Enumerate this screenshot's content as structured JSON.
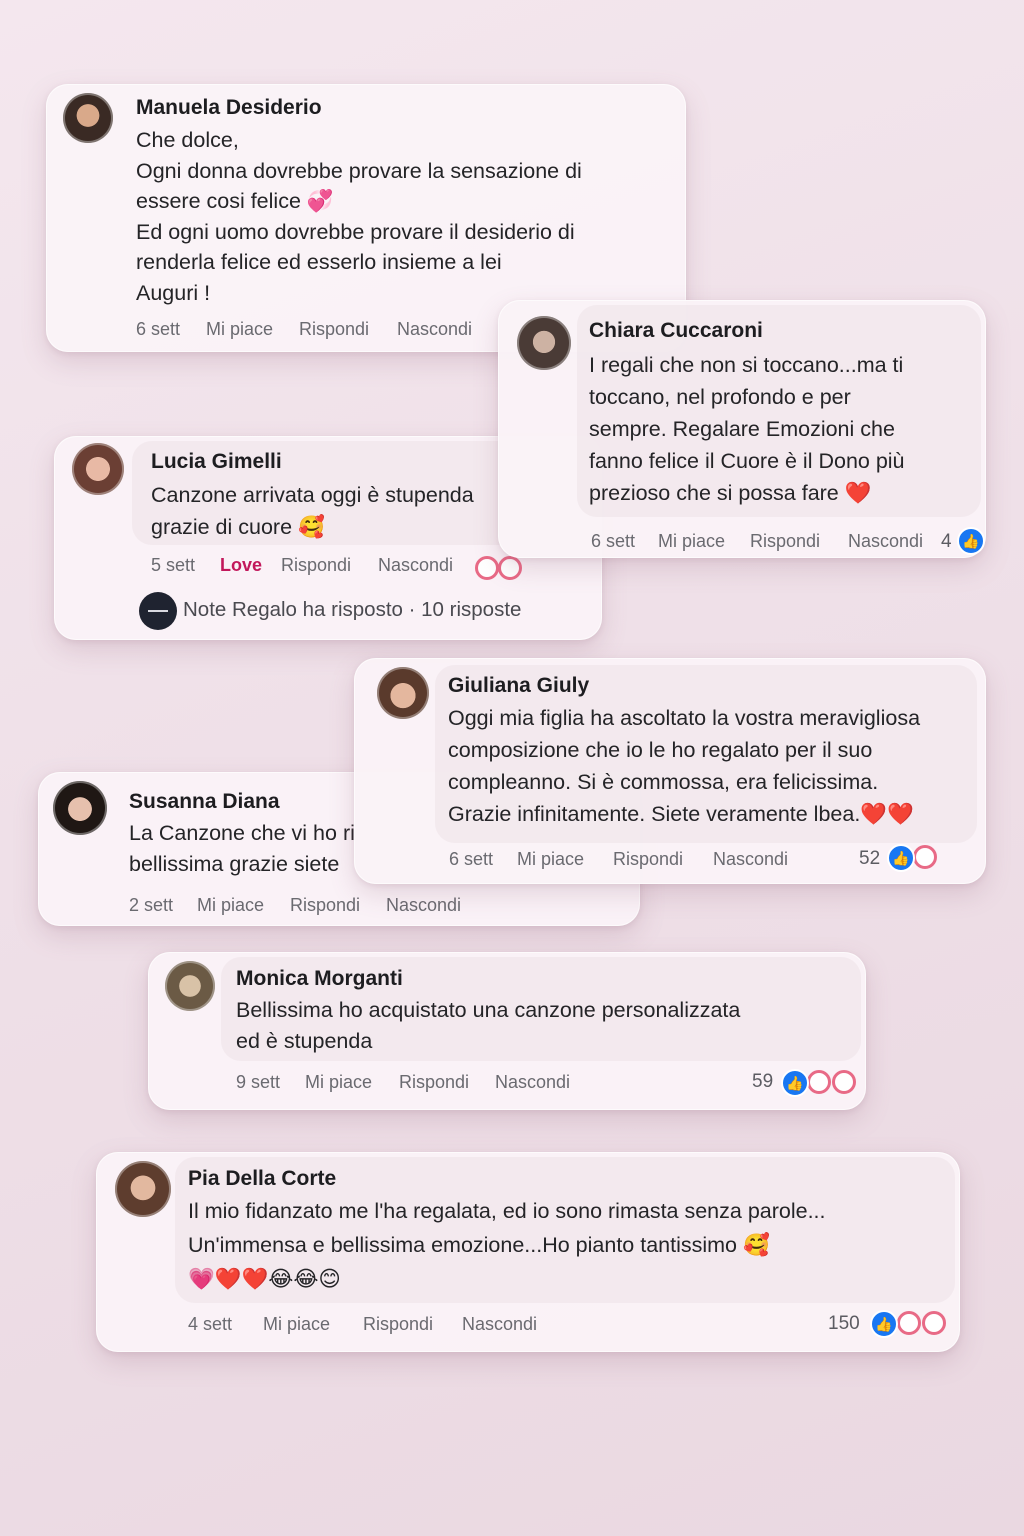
{
  "comments": {
    "manuela": {
      "name": "Manuela Desiderio",
      "lines": [
        "Che dolce,",
        "Ogni donna dovrebbe provare la sensazione di",
        "essere cosi felice 💞",
        "Ed ogni uomo dovrebbe provare il desiderio di",
        "renderla felice ed esserlo insieme a lei",
        "Auguri !"
      ],
      "time": "6 sett",
      "like": "Mi piace",
      "reply": "Rispondi",
      "hide": "Nascondi"
    },
    "chiara": {
      "name": "Chiara Cuccaroni",
      "lines": [
        "I regali che non si toccano...ma ti",
        "toccano, nel profondo e per",
        "sempre. Regalare Emozioni che",
        "fanno felice il Cuore è il Dono più",
        "prezioso che si possa fare ❤️"
      ],
      "time": "6 sett",
      "like": "Mi piace",
      "reply": "Rispondi",
      "hide": "Nascondi",
      "reaction_count": "4"
    },
    "lucia": {
      "name": "Lucia Gimelli",
      "lines": [
        "Canzone arrivata oggi è stupenda",
        "grazie di cuore 🥰"
      ],
      "time": "5 sett",
      "like": "Love",
      "reply": "Rispondi",
      "hide": "Nascondi",
      "replies_summary": "Note Regalo ha risposto · 10 risposte"
    },
    "susanna": {
      "name": "Susanna Diana",
      "lines": [
        "La Canzone che vi ho ri",
        "bellissima grazie siete"
      ],
      "time": "2 sett",
      "like": "Mi piace",
      "reply": "Rispondi",
      "hide": "Nascondi"
    },
    "giuliana": {
      "name": "Giuliana Giuly",
      "lines": [
        "Oggi mia figlia ha ascoltato la vostra meravigliosa",
        "composizione che io le ho regalato per il suo",
        "compleanno. Si è commossa, era felicissima.",
        "Grazie infinitamente. Siete veramente lbea.❤️❤️"
      ],
      "time": "6 sett",
      "like": "Mi piace",
      "reply": "Rispondi",
      "hide": "Nascondi",
      "reaction_count": "52"
    },
    "monica": {
      "name": "Monica Morganti",
      "lines": [
        "Bellissima ho acquistato una canzone personalizzata",
        "ed è stupenda"
      ],
      "time": "9 sett",
      "like": "Mi piace",
      "reply": "Rispondi",
      "hide": "Nascondi",
      "reaction_count": "59"
    },
    "pia": {
      "name": "Pia Della Corte",
      "lines": [
        "Il mio fidanzato me l'ha regalata, ed io sono rimasta senza parole...",
        "Un'immensa e bellissima emozione...Ho pianto tantissimo 🥰",
        "💗❤️❤️😂😂😊"
      ],
      "time": "4 sett",
      "like": "Mi piace",
      "reply": "Rispondi",
      "hide": "Nascondi",
      "reaction_count": "150"
    }
  },
  "icons": {
    "like": "thumbs-up-icon",
    "love": "heart-icon"
  },
  "colors": {
    "like_blue": "#1877f2",
    "love_red": "#f33e58",
    "love_label": "#c2185b"
  }
}
